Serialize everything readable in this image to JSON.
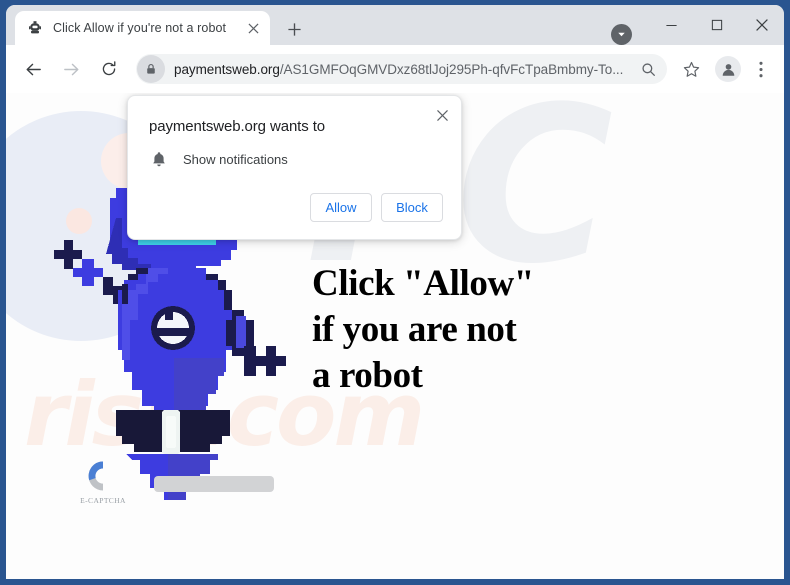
{
  "window": {
    "frame_color": "#2a5590",
    "controls": {
      "download_icon": "download-chevron-icon",
      "minimize_label": "—",
      "maximize_label": "□",
      "close_label": "✕"
    }
  },
  "tabstrip": {
    "active_tab": {
      "favicon": "robot-favicon",
      "title": "Click Allow if you're not a robot",
      "close_label": "✕"
    },
    "new_tab_label": "+"
  },
  "toolbar": {
    "back_icon": "arrow-left-icon",
    "forward_icon": "arrow-right-icon",
    "reload_icon": "reload-icon",
    "omnibox": {
      "lock_icon": "lock-icon",
      "host": "paymentsweb.org",
      "path": "/AS1GMFOqGMVDxz68tlJoj295Ph-qfvFcTpaBmbmy-To...",
      "search_icon": "search-icon"
    },
    "bookmark_icon": "star-icon",
    "profile_icon": "account-avatar-icon",
    "menu_icon": "three-dot-menu-icon"
  },
  "dialog": {
    "title": "paymentsweb.org wants to",
    "close_label": "✕",
    "permission_icon": "bell-icon",
    "permission_label": "Show notifications",
    "allow_label": "Allow",
    "block_label": "Block",
    "button_text_color": "#1a73e8"
  },
  "page": {
    "headline_lines": [
      "Click \"Allow\"",
      "if you are not",
      "a robot"
    ],
    "mascot": {
      "name": "blue-robot-mascot",
      "body_color": "#3d3ce0",
      "body_shade_color": "#4a4ad6",
      "visor_color": "#123a47",
      "visor_rim_color": "#3fd2e8",
      "outline_color": "#1b1b4d"
    },
    "captcha": {
      "logo_name": "e-captcha-logo",
      "label": "E-CAPTCHA",
      "logo_blue": "#4a7fd4",
      "logo_gray": "#bfc2c6"
    },
    "watermarks": {
      "big": "PC",
      "small": "risk.com"
    }
  }
}
